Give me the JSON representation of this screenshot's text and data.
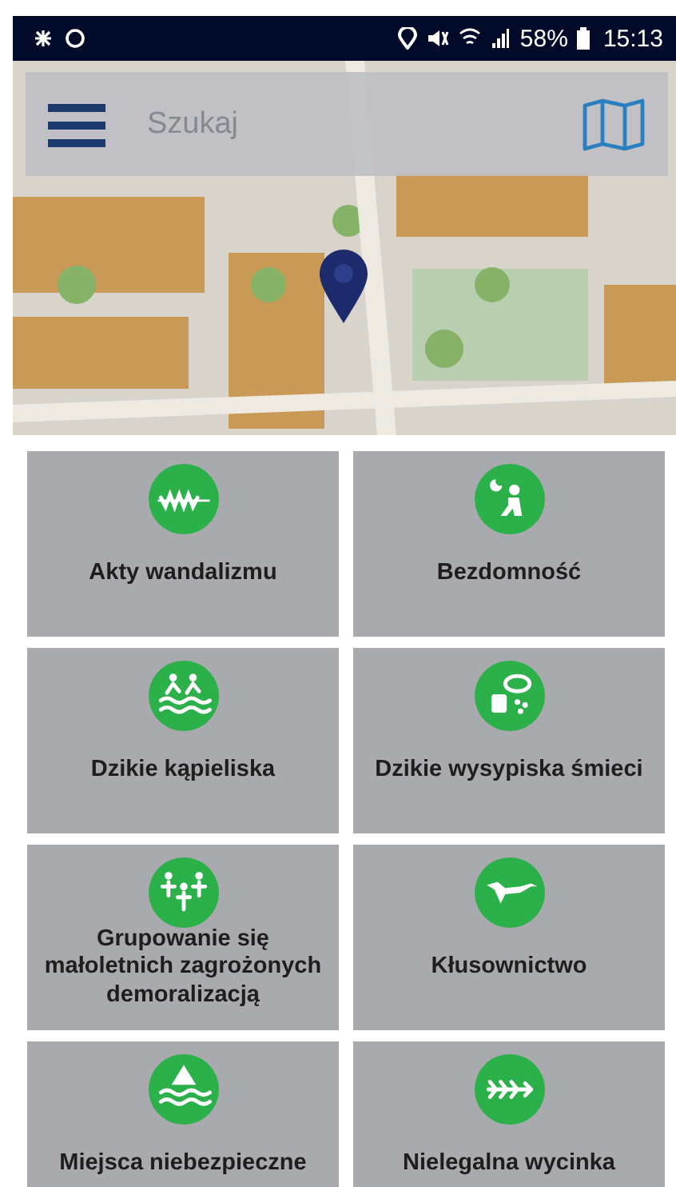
{
  "status_bar": {
    "battery": "58%",
    "time": "15:13"
  },
  "search": {
    "placeholder": "Szukaj"
  },
  "categories": [
    {
      "label": "Akty wandalizmu"
    },
    {
      "label": "Bezdomność"
    },
    {
      "label": "Dzikie kąpieliska"
    },
    {
      "label": "Dzikie wysypiska śmieci"
    },
    {
      "label": "Grupowanie się małoletnich zagrożonych demoralizacją"
    },
    {
      "label": "Kłusownictwo"
    },
    {
      "label": "Miejsca niebezpieczne"
    },
    {
      "label": "Nielegalna wycinka"
    }
  ]
}
